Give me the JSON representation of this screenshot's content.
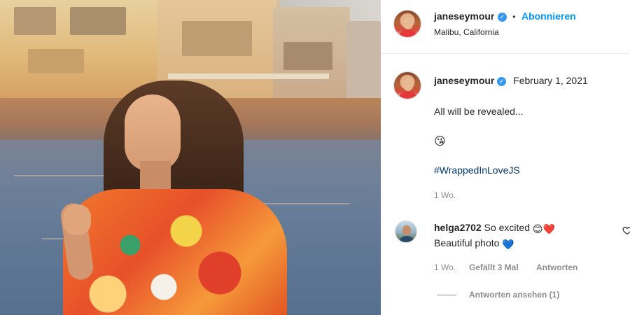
{
  "post": {
    "author": "janeseymour",
    "location": "Malibu, California",
    "follow_label": "Abonnieren",
    "separator": "•"
  },
  "caption": {
    "author": "janeseymour",
    "date": "February 1, 2021",
    "line1": "All will be revealed...",
    "emoji": "😘",
    "hashtag": "#WrappedInLoveJS",
    "age": "1 Wo."
  },
  "comment": {
    "author": "helga2702",
    "text_line1": "So excited",
    "emoji1": "😊❤️",
    "text_line2": "Beautiful photo",
    "emoji2": "💙",
    "age": "1 Wo.",
    "likes": "Gefällt 3 Mal",
    "reply_label": "Antworten",
    "view_replies": "Antworten ansehen (1)"
  },
  "icons": {
    "verified": "verified-badge-icon",
    "like": "heart-outline-icon"
  },
  "colors": {
    "link_blue": "#0095f6",
    "verified_blue": "#3897f0",
    "hashtag": "#00376b",
    "muted": "#8e8e8e",
    "heart_blue": "#4aa3df"
  }
}
